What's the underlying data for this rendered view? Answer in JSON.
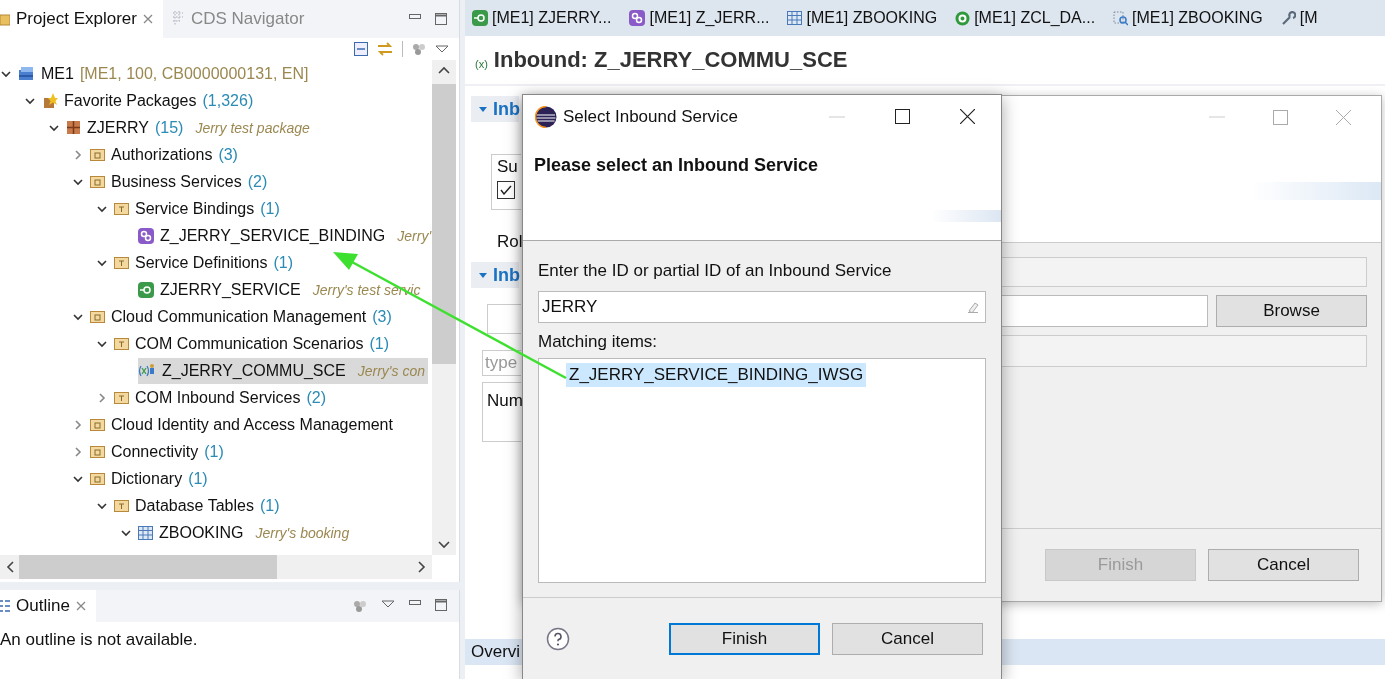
{
  "explorer": {
    "tabs": [
      {
        "label": "Project Explorer",
        "selected": true
      },
      {
        "label": "CDS Navigator",
        "selected": false
      }
    ],
    "tree": [
      {
        "kind": "system",
        "label": "ME1",
        "details": "[ME1, 100, CB0000000131, EN]",
        "expanded": true,
        "selected": false,
        "children": [
          {
            "kind": "favorites",
            "label": "Favorite Packages",
            "count": "(1,326)",
            "expanded": true,
            "selected": false,
            "children": [
              {
                "kind": "package",
                "label": "ZJERRY",
                "count": "(15)",
                "description": "Jerry test package",
                "expanded": true,
                "selected": false,
                "children": [
                  {
                    "kind": "group",
                    "label": "Authorizations",
                    "count": "(3)",
                    "expanded": false,
                    "selected": false
                  },
                  {
                    "kind": "group",
                    "label": "Business Services",
                    "count": "(2)",
                    "expanded": true,
                    "selected": false,
                    "children": [
                      {
                        "kind": "type",
                        "label": "Service Bindings",
                        "count": "(1)",
                        "expanded": true,
                        "selected": false,
                        "children": [
                          {
                            "kind": "binding",
                            "label": "Z_JERRY_SERVICE_BINDING",
                            "description": "Jerry'",
                            "selected": false
                          }
                        ]
                      },
                      {
                        "kind": "type",
                        "label": "Service Definitions",
                        "count": "(1)",
                        "expanded": true,
                        "selected": false,
                        "children": [
                          {
                            "kind": "service",
                            "label": "ZJERRY_SERVICE",
                            "description": "Jerry's test servic",
                            "selected": false
                          }
                        ]
                      }
                    ]
                  },
                  {
                    "kind": "group",
                    "label": "Cloud Communication Management",
                    "count": "(3)",
                    "expanded": true,
                    "selected": false,
                    "children": [
                      {
                        "kind": "type",
                        "label": "COM Communication Scenarios",
                        "count": "(1)",
                        "expanded": true,
                        "selected": false,
                        "children": [
                          {
                            "kind": "scenario",
                            "label": "Z_JERRY_COMMU_SCE",
                            "description": "Jerry's con",
                            "selected": true
                          }
                        ]
                      },
                      {
                        "kind": "type",
                        "label": "COM Inbound Services",
                        "count": "(2)",
                        "expanded": false,
                        "selected": false
                      }
                    ]
                  },
                  {
                    "kind": "group",
                    "label": "Cloud Identity and Access Management",
                    "expanded": false,
                    "selected": false
                  },
                  {
                    "kind": "group",
                    "label": "Connectivity",
                    "count": "(1)",
                    "expanded": false,
                    "selected": false
                  },
                  {
                    "kind": "group",
                    "label": "Dictionary",
                    "count": "(1)",
                    "expanded": true,
                    "selected": false,
                    "children": [
                      {
                        "kind": "type",
                        "label": "Database Tables",
                        "count": "(1)",
                        "expanded": true,
                        "selected": false,
                        "children": [
                          {
                            "kind": "table",
                            "label": "ZBOOKING",
                            "description": "Jerry's booking",
                            "expanded": true,
                            "selected": false
                          }
                        ]
                      }
                    ]
                  }
                ]
              }
            ]
          }
        ]
      }
    ]
  },
  "outline": {
    "tab": "Outline",
    "message": "An outline is not available."
  },
  "editor": {
    "tabs": [
      {
        "kind": "service",
        "label": "[ME1] ZJERRY...",
        "selected": false
      },
      {
        "kind": "binding",
        "label": "[ME1] Z_JERR...",
        "selected": false
      },
      {
        "kind": "table",
        "label": "[ME1] ZBOOKING",
        "selected": false
      },
      {
        "kind": "class",
        "label": "[ME1] ZCL_DA...",
        "selected": false
      },
      {
        "kind": "cds",
        "label": "[ME1] ZBOOKING",
        "selected": false
      },
      {
        "kind": "tool",
        "label": "[M",
        "selected": false
      }
    ],
    "title_icon": "(x)",
    "title": "Inbound: Z_JERRY_COMMU_SCE",
    "sections": [
      {
        "title": "Inb",
        "expanded": true
      },
      {
        "title": "Inb",
        "expanded": true
      }
    ],
    "group_label": "Su",
    "checkbox": {
      "checked": true
    },
    "role_label": "Rol",
    "filter": {
      "placeholder": "type"
    },
    "table_text": "Num",
    "bottom_tab": "Overvi"
  },
  "wizard": {
    "browse": "Browse",
    "buttons": [
      {
        "label": "Finish",
        "disabled": true
      },
      {
        "label": "Cancel",
        "disabled": false
      }
    ]
  },
  "dialog": {
    "title": "Select Inbound Service",
    "heading": "Please select an Inbound Service",
    "prompt": "Enter the ID or partial ID of an Inbound Service",
    "search": {
      "value": "JERRY"
    },
    "list_label": "Matching items:",
    "items": [
      {
        "label": "Z_JERRY_SERVICE_BINDING_IWSG",
        "selected": true
      }
    ],
    "buttons": [
      {
        "label": "Finish",
        "default": true
      },
      {
        "label": "Cancel",
        "default": false
      }
    ]
  }
}
